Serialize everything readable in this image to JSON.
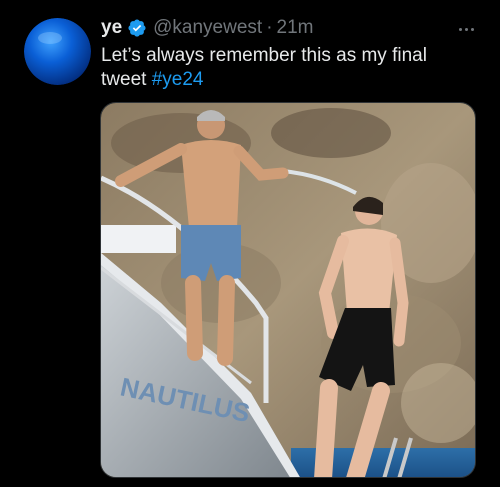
{
  "tweet": {
    "display_name": "ye",
    "verified": true,
    "handle": "@kanyewest",
    "separator": "·",
    "time": "21m",
    "text_before": "Let’s always remember this as my final tweet ",
    "hashtag": "#ye24",
    "media_description": "photo",
    "yacht_lettering": "NAUTILUS"
  },
  "icons": {
    "avatar": "blue-sphere-avatar",
    "verified": "verified-badge-icon",
    "more": "more-options-icon"
  },
  "colors": {
    "background": "#000000",
    "text": "#e7e9ea",
    "secondary": "#71767b",
    "link": "#1d9bf0",
    "badge": "#1d9bf0"
  }
}
